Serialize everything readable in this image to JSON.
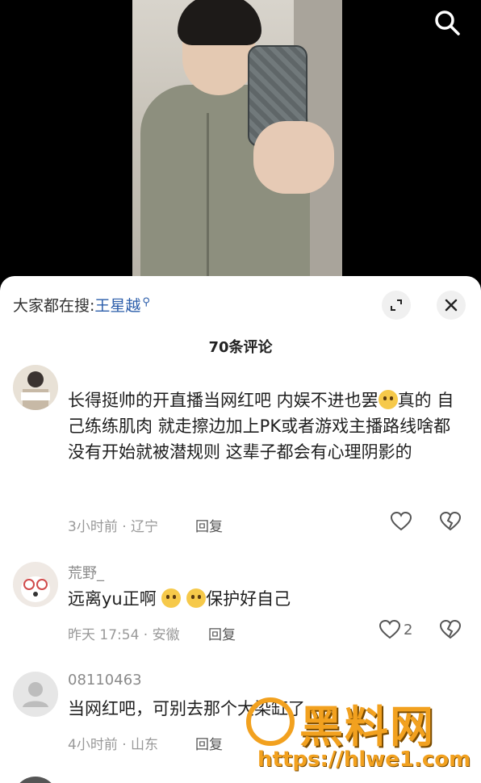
{
  "sheet": {
    "hot_search_prefix": "大家都在搜:",
    "hot_search_keyword": "王星越",
    "comment_count": "70条评论"
  },
  "comments": [
    {
      "username": "",
      "text_parts": [
        "长得挺帅的开直播当网红吧 内娱不进也罢",
        "真的 自己练练肌肉 就走擦边加上PK或者游戏主播路线啥都没有开始就被潜规则 这辈子都会有心理阴影的"
      ],
      "meta": "3小时前 · 辽宁",
      "reply_label": "回复",
      "likes": ""
    },
    {
      "username": "荒野_",
      "text_parts": [
        "远离yu正啊",
        "保护好自己"
      ],
      "meta": "昨天 17:54 · 安徽",
      "reply_label": "回复",
      "likes": "2"
    },
    {
      "username": "08110463",
      "text_parts": [
        "当网红吧，可别去那个大染缸了"
      ],
      "meta": "4小时前 · 山东",
      "reply_label": "回复",
      "likes": ""
    }
  ],
  "watermark": {
    "title": "黑料网",
    "url": "https://hlwe1.com"
  },
  "colors": {
    "link_blue": "#2a5caa",
    "watermark_orange": "#f2a11f"
  }
}
